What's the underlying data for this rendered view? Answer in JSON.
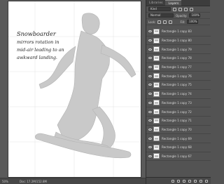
{
  "document": {
    "quote_lines": [
      "Snowboarder",
      "mirrors rotation in",
      "mid-air leading to an",
      "awkward landing."
    ],
    "zoom": "50%",
    "doc_info": "Doc: 17.2M/152.8M"
  },
  "panel": {
    "tabs": [
      "Libraries",
      "Layers"
    ],
    "kind_label": "Kind",
    "blend_mode": "Normal",
    "opacity_label": "Opacity:",
    "opacity_value": "100%",
    "lock_label": "Lock:",
    "fill_label": "Fill:",
    "fill_value": "100%"
  },
  "layers": [
    {
      "name": "Rectangle 1 copy 83"
    },
    {
      "name": "Rectangle 1 copy 80"
    },
    {
      "name": "Rectangle 1 copy 79"
    },
    {
      "name": "Rectangle 1 copy 78"
    },
    {
      "name": "Rectangle 1 copy 77"
    },
    {
      "name": "Rectangle 1 copy 76"
    },
    {
      "name": "Rectangle 1 copy 75"
    },
    {
      "name": "Rectangle 1 copy 74"
    },
    {
      "name": "Rectangle 1 copy 73"
    },
    {
      "name": "Rectangle 1 copy 72"
    },
    {
      "name": "Rectangle 1 copy 71"
    },
    {
      "name": "Rectangle 1 copy 70"
    },
    {
      "name": "Rectangle 1 copy 69"
    },
    {
      "name": "Rectangle 1 copy 68"
    },
    {
      "name": "Rectangle 1 copy 67"
    }
  ]
}
